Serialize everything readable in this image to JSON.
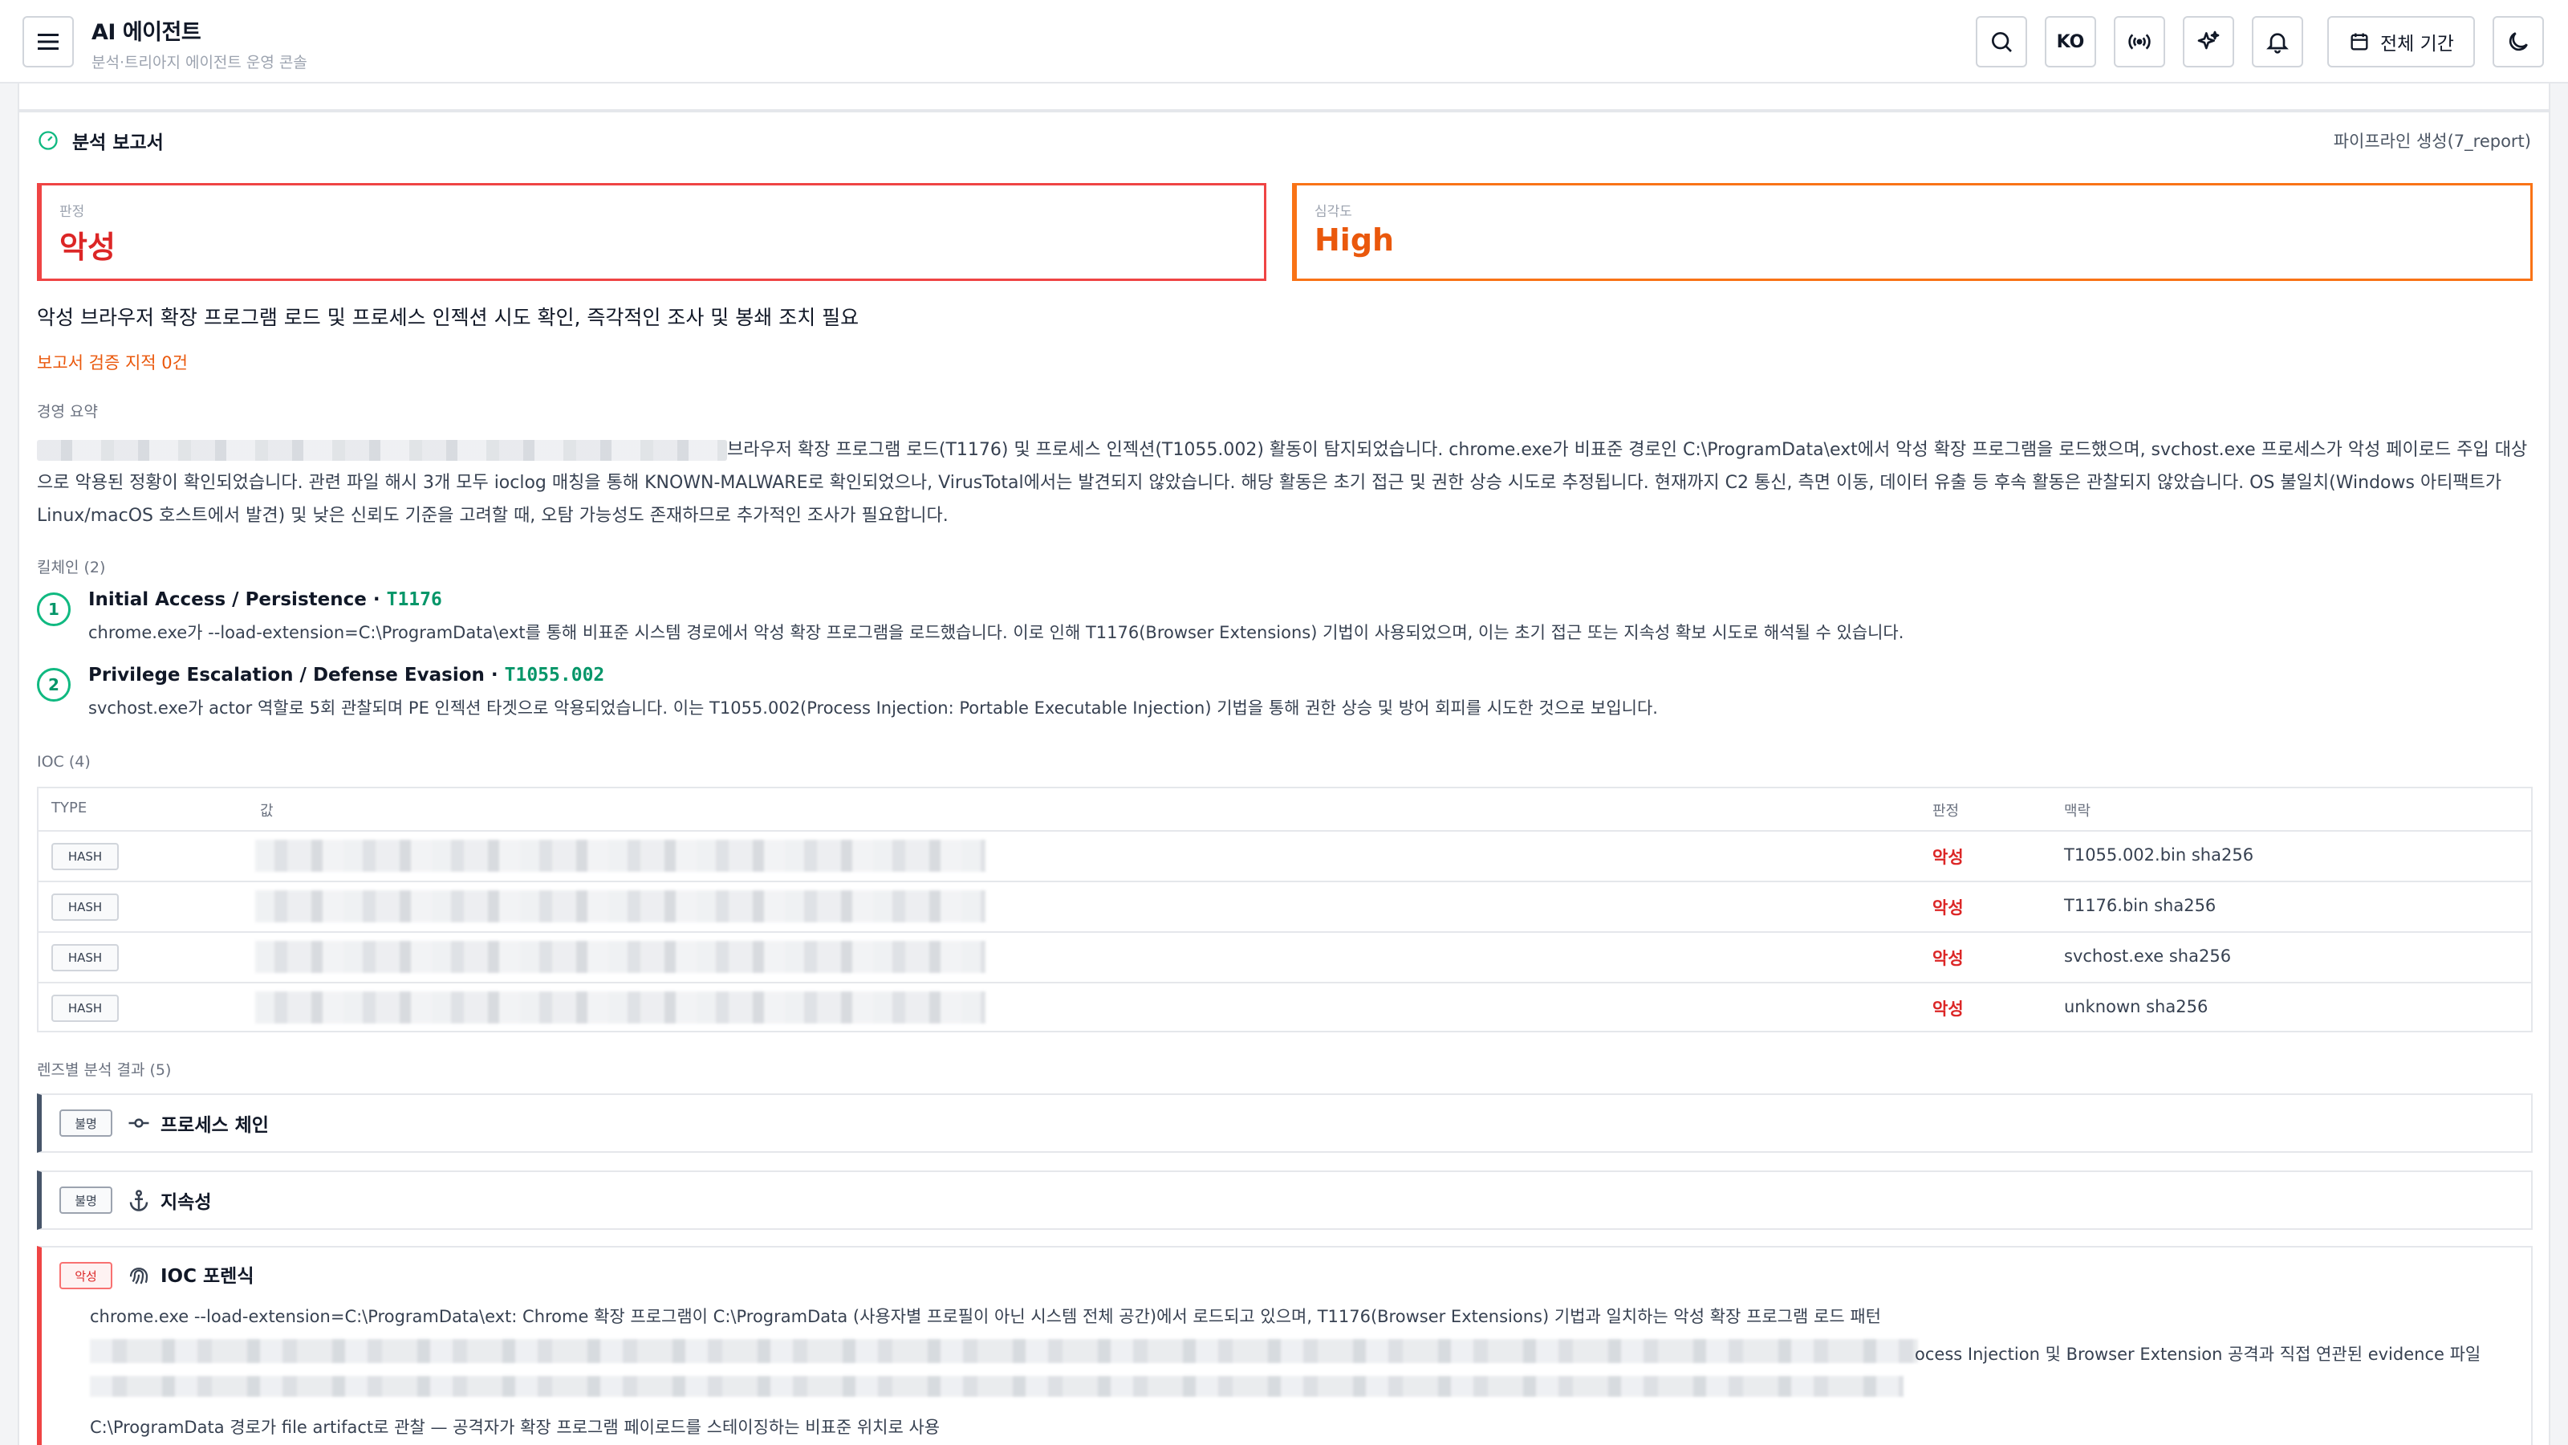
{
  "header": {
    "title": "AI 에이전트",
    "subtitle": "분석·트리아지 에이전트 운영 콘솔",
    "lang_label": "KO",
    "period_label": "전체 기간"
  },
  "report": {
    "title": "분석 보고서",
    "source": "파이프라인 생성(7_report)",
    "verdict_label": "판정",
    "verdict_value": "악성",
    "severity_label": "심각도",
    "severity_value": "High",
    "headline": "악성 브라우저 확장 프로그램 로드 및 프로세스 인젝션 시도 확인, 즉각적인 조사 및 봉쇄 조치 필요",
    "review_note": "보고서 검증 지적 0건",
    "summary_label": "경영 요약",
    "summary_text": "브라우저 확장 프로그램 로드(T1176) 및 프로세스 인젝션(T1055.002) 활동이 탐지되었습니다. chrome.exe가 비표준 경로인 C:\\ProgramData\\ext에서 악성 확장 프로그램을 로드했으며, svchost.exe 프로세스가 악성 페이로드 주입 대상으로 악용된 정황이 확인되었습니다. 관련 파일 해시 3개 모두 ioclog 매칭을 통해 KNOWN-MALWARE로 확인되었으나, VirusTotal에서는 발견되지 않았습니다. 해당 활동은 초기 접근 및 권한 상승 시도로 추정됩니다. 현재까지 C2 통신, 측면 이동, 데이터 유출 등 후속 활동은 관찰되지 않았습니다. OS 불일치(Windows 아티팩트가 Linux/macOS 호스트에서 발견) 및 낮은 신뢰도 기준을 고려할 때, 오탐 가능성도 존재하므로 추가적인 조사가 필요합니다.",
    "killchain_label": "킬체인 (2)",
    "killchain": [
      {
        "num": "1",
        "title": "Initial Access / Persistence · ",
        "technique": "T1176",
        "desc": "chrome.exe가 --load-extension=C:\\ProgramData\\ext를 통해 비표준 시스템 경로에서 악성 확장 프로그램을 로드했습니다. 이로 인해 T1176(Browser Extensions) 기법이 사용되었으며, 이는 초기 접근 또는 지속성 확보 시도로 해석될 수 있습니다."
      },
      {
        "num": "2",
        "title": "Privilege Escalation / Defense Evasion · ",
        "technique": "T1055.002",
        "desc": "svchost.exe가 actor 역할로 5회 관찰되며 PE 인젝션 타겟으로 악용되었습니다. 이는 T1055.002(Process Injection: Portable Executable Injection) 기법을 통해 권한 상승 및 방어 회피를 시도한 것으로 보입니다."
      }
    ],
    "ioc_label": "IOC (4)",
    "ioc_columns": {
      "type": "TYPE",
      "value": "값",
      "verdict": "판정",
      "context": "맥락"
    },
    "ioc_rows": [
      {
        "type": "HASH",
        "verdict": "악성",
        "context": "T1055.002.bin sha256"
      },
      {
        "type": "HASH",
        "verdict": "악성",
        "context": "T1176.bin sha256"
      },
      {
        "type": "HASH",
        "verdict": "악성",
        "context": "svchost.exe sha256"
      },
      {
        "type": "HASH",
        "verdict": "악성",
        "context": "unknown sha256"
      }
    ],
    "lens_label": "렌즈별 분석 결과 (5)",
    "lenses": [
      {
        "badge": "불명",
        "title": "프로세스 체인",
        "icon": "commit-icon"
      },
      {
        "badge": "불명",
        "title": "지속성",
        "icon": "anchor-icon"
      },
      {
        "badge": "악성",
        "title": "IOC 포렌식",
        "icon": "fingerprint-icon",
        "line1": "chrome.exe --load-extension=C:\\ProgramData\\ext: Chrome 확장 프로그램이 C:\\ProgramData (사용자별 프로필이 아닌 시스템 전체 공간)에서 로드되고 있으며, T1176(Browser Extensions) 기법과 일치하는 악성 확장 프로그램 로드 패턴",
        "line2_tail": "ocess Injection 및 Browser Extension 공격과 직접 연관된 evidence 파일",
        "line3": "C:\\ProgramData 경로가 file artifact로 관찰 — 공격자가 확장 프로그램 페이로드를 스테이징하는 비표준 위치로 사용"
      }
    ]
  },
  "colors": {
    "malicious": "#dc2626",
    "high": "#ea580c",
    "accent_green": "#059669",
    "unknown_border": "#475569"
  }
}
